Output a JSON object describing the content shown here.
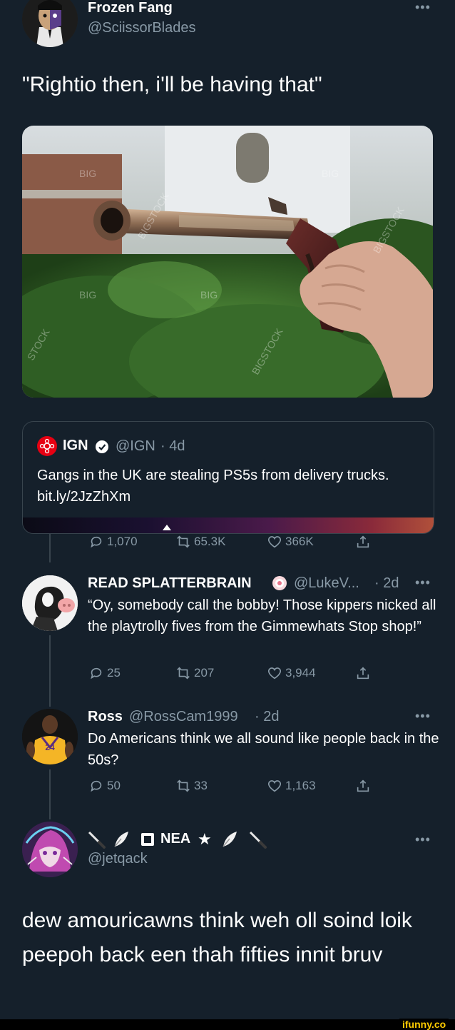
{
  "main_tweet": {
    "display_name": "Frozen Fang",
    "handle": "@SciissorBlades",
    "text": "\"Rightio then, i'll be having that\"",
    "image_watermarks": [
      "BIG",
      "BIG",
      "BIG",
      "BIG",
      "BIGSTOCK",
      "BIGSTOCK",
      "STOCK",
      "BIGSTOCK"
    ]
  },
  "quoted_tweet": {
    "display_name": "IGN",
    "handle": "@IGN",
    "time": "· 4d",
    "text": "Gangs in the UK are stealing PS5s from delivery trucks. bit.ly/2JzZhXm"
  },
  "main_actions": {
    "replies": "1,070",
    "retweets": "65.3K",
    "likes": "366K"
  },
  "replies": [
    {
      "display_name": "READ SPLATTERBRAIN",
      "handle": "@LukeV...",
      "time": "· 2d",
      "text": "“Oy, somebody call the bobby! Those kippers nicked all the playtrolly fives from the Gimmewhats Stop shop!”",
      "replies": "25",
      "retweets": "207",
      "likes": "3,944"
    },
    {
      "display_name": "Ross",
      "handle": "@RossCam1999",
      "time": "· 2d",
      "text": "Do Americans think we all sound like people back in the 50s?",
      "jersey_number": "24",
      "replies": "50",
      "retweets": "33",
      "likes": "1,163"
    }
  ],
  "final_tweet": {
    "display_name": "NEA",
    "handle": "@jetqack",
    "text": "dew amouricawns think weh oll soind loik peepoh back een thah fifties innit bruv"
  },
  "colors": {
    "background": "#15202b",
    "muted": "#8899a6",
    "border": "#38444d",
    "ign_red": "#e60012",
    "ifunny_yellow": "#ffcc00"
  },
  "watermark": "ifunny.co"
}
